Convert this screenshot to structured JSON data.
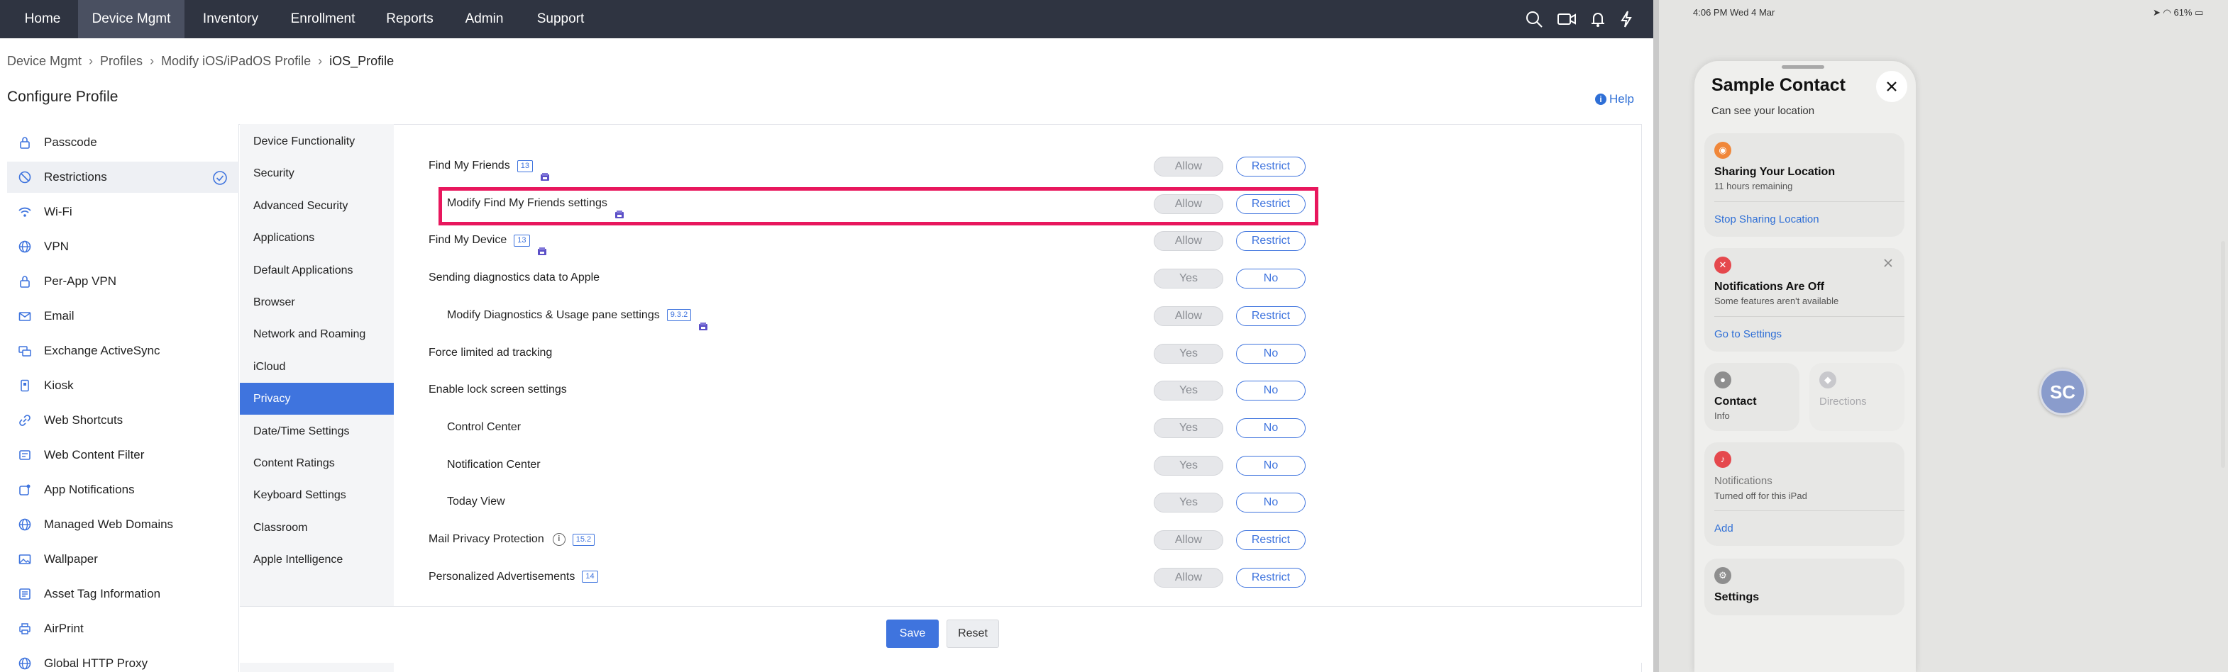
{
  "topnav": {
    "items": [
      "Home",
      "Device Mgmt",
      "Inventory",
      "Enrollment",
      "Reports",
      "Admin",
      "Support"
    ],
    "active": "Device Mgmt"
  },
  "breadcrumb": [
    "Device Mgmt",
    "Profiles",
    "Modify iOS/iPadOS Profile",
    "iOS_Profile"
  ],
  "page_title": "Configure Profile",
  "help_label": "Help",
  "payloads": [
    {
      "label": "Passcode",
      "icon": "lock-icon"
    },
    {
      "label": "Restrictions",
      "icon": "restriction-icon",
      "selected": true
    },
    {
      "label": "Wi-Fi",
      "icon": "wifi-icon"
    },
    {
      "label": "VPN",
      "icon": "globe-icon"
    },
    {
      "label": "Per-App VPN",
      "icon": "lock-icon"
    },
    {
      "label": "Email",
      "icon": "mail-icon"
    },
    {
      "label": "Exchange ActiveSync",
      "icon": "sync-icon"
    },
    {
      "label": "Kiosk",
      "icon": "kiosk-icon"
    },
    {
      "label": "Web Shortcuts",
      "icon": "link-icon"
    },
    {
      "label": "Web Content Filter",
      "icon": "filter-icon"
    },
    {
      "label": "App Notifications",
      "icon": "notification-icon"
    },
    {
      "label": "Managed Web Domains",
      "icon": "globe-icon"
    },
    {
      "label": "Wallpaper",
      "icon": "image-icon"
    },
    {
      "label": "Asset Tag Information",
      "icon": "tag-icon"
    },
    {
      "label": "AirPrint",
      "icon": "printer-icon"
    },
    {
      "label": "Global HTTP Proxy",
      "icon": "globe-icon"
    }
  ],
  "sub_sections": [
    "Device Functionality",
    "Security",
    "Advanced Security",
    "Applications",
    "Default Applications",
    "Browser",
    "Network and Roaming",
    "iCloud",
    "Privacy",
    "Date/Time Settings",
    "Content Ratings",
    "Keyboard Settings",
    "Classroom",
    "Apple Intelligence"
  ],
  "active_sub_section": "Privacy",
  "settings": [
    {
      "label": "Find My Friends",
      "badge": "13",
      "lock": true,
      "indent": false,
      "off": "Allow",
      "on": "Restrict"
    },
    {
      "label": "Modify Find My Friends settings",
      "badge": "",
      "lock": true,
      "indent": true,
      "off": "Allow",
      "on": "Restrict",
      "highlighted": true
    },
    {
      "label": "Find My Device",
      "badge": "13",
      "lock": true,
      "indent": false,
      "off": "Allow",
      "on": "Restrict"
    },
    {
      "label": "Sending diagnostics data to Apple",
      "badge": "",
      "lock": false,
      "indent": false,
      "off": "Yes",
      "on": "No"
    },
    {
      "label": "Modify Diagnostics & Usage pane settings",
      "badge": "9.3.2",
      "lock": true,
      "indent": true,
      "off": "Allow",
      "on": "Restrict"
    },
    {
      "label": "Force limited ad tracking",
      "badge": "",
      "lock": false,
      "indent": false,
      "off": "Yes",
      "on": "No"
    },
    {
      "label": "Enable lock screen settings",
      "badge": "",
      "lock": false,
      "indent": false,
      "off": "Yes",
      "on": "No"
    },
    {
      "label": "Control Center",
      "badge": "",
      "lock": false,
      "indent": true,
      "off": "Yes",
      "on": "No"
    },
    {
      "label": "Notification Center",
      "badge": "",
      "lock": false,
      "indent": true,
      "off": "Yes",
      "on": "No"
    },
    {
      "label": "Today View",
      "badge": "",
      "lock": false,
      "indent": true,
      "off": "Yes",
      "on": "No"
    },
    {
      "label": "Mail Privacy Protection",
      "badge": "15.2",
      "lock": false,
      "info": true,
      "indent": false,
      "off": "Allow",
      "on": "Restrict"
    },
    {
      "label": "Personalized Advertisements",
      "badge": "14",
      "lock": false,
      "indent": false,
      "off": "Allow",
      "on": "Restrict"
    }
  ],
  "footer": {
    "save": "Save",
    "reset": "Reset"
  },
  "ipad": {
    "time": "4:06 PM  Wed 4 Mar",
    "battery": "61%",
    "sheet_title": "Sample Contact",
    "sheet_subtitle": "Can see your location",
    "sharing": {
      "title": "Sharing Your Location",
      "sub": "11 hours remaining",
      "link": "Stop Sharing Location"
    },
    "notifications_off": {
      "title": "Notifications Are Off",
      "sub": "Some features aren't available",
      "link": "Go to Settings"
    },
    "contact": {
      "title": "Contact",
      "sub": "Info"
    },
    "directions": {
      "title": "Directions"
    },
    "notifications": {
      "title": "Notifications",
      "sub": "Turned off for this iPad",
      "link": "Add"
    },
    "settings": {
      "title": "Settings"
    },
    "avatar_initials": "SC"
  },
  "colors": {
    "nav_bg": "#2f3441",
    "accent": "#3f74de",
    "highlight_border": "#e8175d",
    "orange": "#f0873a",
    "red": "#e5484d"
  }
}
